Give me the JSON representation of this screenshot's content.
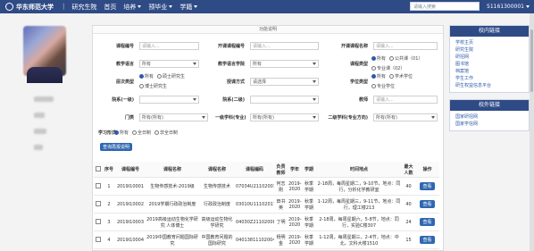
{
  "header": {
    "logo_text": "华东师范大学",
    "system_name": "研究生院",
    "nav": [
      "首页",
      "培养",
      "预毕业",
      "学籍"
    ],
    "search_placeholder": "请输入搜索",
    "user_id": "51161300001",
    "bg": "#2f4b86"
  },
  "panel": {
    "title": "功能说明"
  },
  "form": {
    "course_id_label": "课程编号",
    "course_id_ph": "请输入...",
    "open_course_id_label": "开课课程编号",
    "open_course_id_ph": "请输入...",
    "course_name_label": "开课课程名称",
    "course_name_ph": "请输入...",
    "teach_lang_label": "教学语言",
    "teach_lang_value": "所有",
    "teach_dept_label": "教学语言学院",
    "teach_dept_value": "所有",
    "course_type_label": "课程类型",
    "course_type_opts": [
      "所有",
      "公共课（01）",
      "专业课（02）"
    ],
    "level_label": "层次类型",
    "level_opts": [
      "所有",
      "硕士研究生",
      "博士研究生"
    ],
    "teach_method_label": "授课方式",
    "teach_method_value": "请选择",
    "degree_type_label": "学位类型",
    "degree_type_opts": [
      "所有",
      "学术学位",
      "专业学位"
    ],
    "cat1_label": "院系(一级)",
    "cat2_label": "院系(二级)",
    "teacher_label": "教师",
    "teacher_ph": "请输入...",
    "category_label": "门类",
    "category_value": "所有(所有)",
    "subject1_label": "一级学科(专业)",
    "subject1_value": "所有(所有)",
    "subject2_label": "二级学科(专业方向)",
    "subject2_value": "所有(所有)",
    "study_mode_label": "学习形式",
    "study_mode_opts": [
      "所有",
      "全日制",
      "非全日制"
    ],
    "search_button": "查询再报说明"
  },
  "table": {
    "headers": [
      "序号",
      "课程编号",
      "课程名称",
      "课程名称",
      "课程编码",
      "负责教师",
      "学年",
      "学期",
      "时间地点",
      "最大人数",
      "操作"
    ],
    "rows": [
      [
        "1",
        "2019I10001",
        "生物传感技术-2019级",
        "生物传感技术",
        "07034U21102001",
        "何志刚",
        "2019-2020",
        "秋季学期",
        "2-18周，每周星期二，9-10节，地点：同行，分析化学教研室",
        "40",
        "查看"
      ],
      [
        "2",
        "2019I10002",
        "2019学期行政政治制度",
        "行政政治制度",
        "03010U11102017",
        "田书英",
        "2019-2020",
        "秋季学期",
        "1-12周，每周星期三，9-11节，地点：同行，理工楼213",
        "40",
        "查看"
      ],
      [
        "3",
        "2019I10003",
        "2019高级运动生物化学研究 人体博士",
        "高级运动生物化学研究",
        "04030Z21102008",
        "丁明",
        "2019-2020",
        "秋季学期",
        "2-18周，每周星期六，5-8节，地点：同行，实验C楼307",
        "24",
        "查看"
      ],
      [
        "4",
        "2019I10004",
        "2019中国教育问题国际研究",
        "中国教育问题的国际研究",
        "04013811102004",
        "杨明金",
        "2019-2020",
        "秋季学期",
        "1-12周，每周星期三，2-4节，地点：中北，文科大楼1510",
        "15",
        "查看"
      ]
    ]
  },
  "sidebar_cards": [
    {
      "title": "校内链接",
      "links": [
        "学校主页",
        "研究生院",
        "研招网",
        "图书馆",
        "档案馆",
        "学生工作",
        "研生权益信息平台"
      ]
    },
    {
      "title": "校外链接",
      "links": [
        "国家研招网",
        "国家学信网"
      ]
    }
  ]
}
